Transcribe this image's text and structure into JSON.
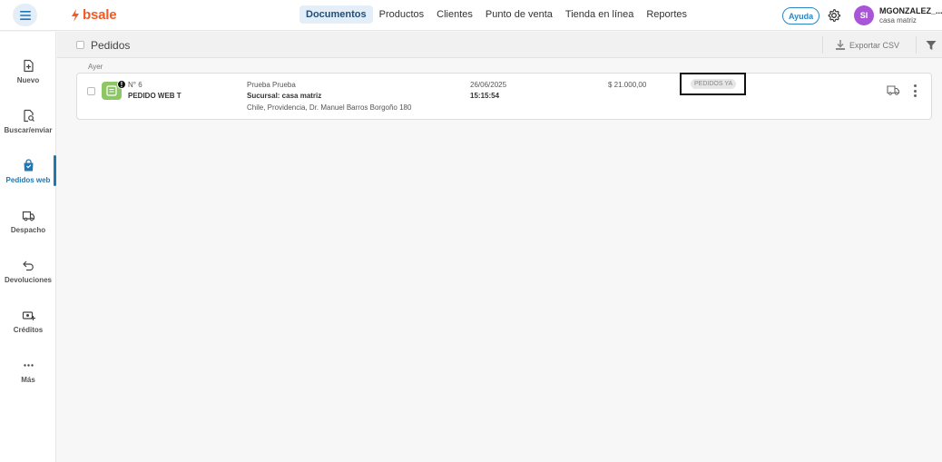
{
  "topbar": {
    "logo_text": "bsale",
    "nav": [
      {
        "label": "Documentos",
        "active": true
      },
      {
        "label": "Productos",
        "active": false
      },
      {
        "label": "Clientes",
        "active": false
      },
      {
        "label": "Punto de venta",
        "active": false
      },
      {
        "label": "Tienda en línea",
        "active": false
      },
      {
        "label": "Reportes",
        "active": false
      }
    ],
    "help_label": "Ayuda",
    "user": {
      "initials": "SI",
      "name": "MGONZALEZ_...",
      "branch": "casa matriz"
    }
  },
  "sidebar": {
    "items": [
      {
        "label": "Nuevo",
        "icon": "new-document-icon",
        "active": false
      },
      {
        "label": "Buscar/enviar",
        "icon": "search-document-icon",
        "active": false
      },
      {
        "label": "Pedidos web",
        "icon": "shopping-bag-icon",
        "active": true
      },
      {
        "label": "Despacho",
        "icon": "truck-icon",
        "active": false
      },
      {
        "label": "Devoluciones",
        "icon": "return-arrow-icon",
        "active": false
      },
      {
        "label": "Créditos",
        "icon": "credit-icon",
        "active": false
      },
      {
        "label": "Más",
        "icon": "more-dots-icon",
        "active": false
      }
    ]
  },
  "page": {
    "title": "Pedidos",
    "export_label": "Exportar CSV",
    "group_label": "Ayer"
  },
  "orders": [
    {
      "number": "N° 6",
      "type": "PEDIDO WEB T",
      "client": "Prueba Prueba",
      "branch": "Sucursal: casa matriz",
      "address": "Chile, Providencia, Dr. Manuel Barros Borgoño 180",
      "date": "26/06/2025",
      "time": "15:15:54",
      "amount": "$ 21.000,00",
      "tag": "PEDIDOS YA",
      "alert": "!"
    }
  ],
  "colors": {
    "brand": "#f05a28",
    "accent": "#1f77b4",
    "doc_icon": "#8cc665",
    "avatar": "#a855d8"
  }
}
